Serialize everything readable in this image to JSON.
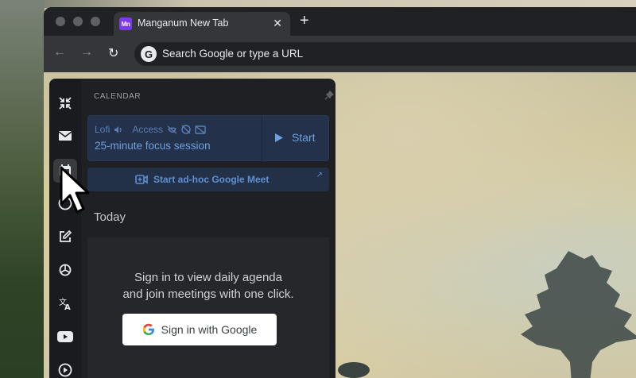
{
  "browser": {
    "tab": {
      "favicon_text": "Mn",
      "title": "Manganum New Tab",
      "close": "✕"
    },
    "new_tab": "+",
    "nav": {
      "back": "←",
      "forward": "→",
      "reload": "↻"
    },
    "omnibox": {
      "logo": "G",
      "placeholder": "Search Google or type a URL"
    }
  },
  "sidebar": {
    "title": "CALENDAR",
    "rail_icons": [
      "shrink-arrows-icon",
      "mail-icon",
      "calendar-icon",
      "compass-icon",
      "edit-icon",
      "openai-icon",
      "translate-icon",
      "youtube-icon",
      "play-circle-icon"
    ],
    "focus": {
      "mode": "Lofi",
      "access": "Access",
      "title": "25-minute focus session",
      "start_label": "Start"
    },
    "meet": {
      "label": "Start ad-hoc Google Meet"
    },
    "today": "Today",
    "agenda": {
      "line1": "Sign in to view daily agenda",
      "line2": "and join meetings with one click.",
      "signin_label": "Sign in with Google"
    }
  },
  "colors": {
    "accent": "#6ea0e0",
    "panel": "#1f2023",
    "focus_bg": "#23324a",
    "favicon": "#7c3aed"
  }
}
